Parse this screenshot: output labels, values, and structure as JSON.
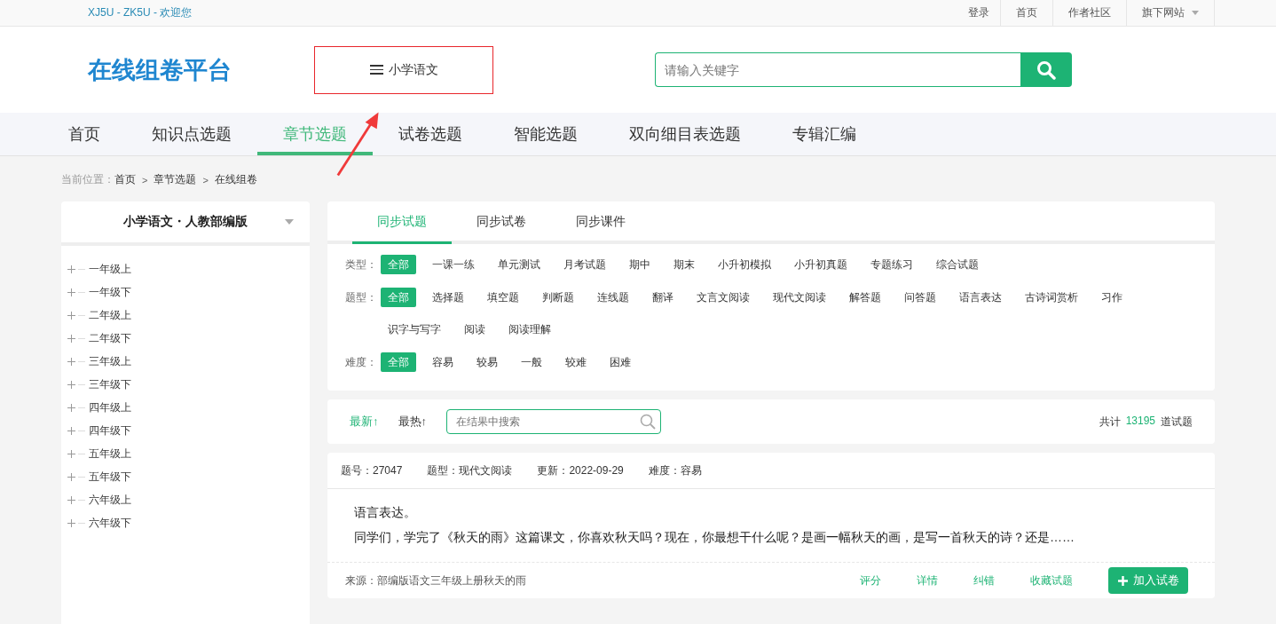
{
  "top_bar": {
    "welcome": "XJ5U - ZK5U - 欢迎您",
    "links": [
      "登录",
      "首页",
      "作者社区",
      "旗下网站"
    ]
  },
  "header": {
    "logo": "在线组卷平台",
    "subject": {
      "label": "小学语文",
      "highlighted": true
    },
    "search": {
      "placeholder": "请输入关键字"
    }
  },
  "nav": [
    {
      "label": "首页",
      "selected": false
    },
    {
      "label": "知识点选题",
      "selected": false
    },
    {
      "label": "章节选题",
      "selected": true
    },
    {
      "label": "试卷选题",
      "selected": false
    },
    {
      "label": "智能选题",
      "selected": false
    },
    {
      "label": "双向细目表选题",
      "selected": false
    },
    {
      "label": "专辑汇编",
      "selected": false
    }
  ],
  "breadcrumb": {
    "label": "当前位置：",
    "items": [
      "首页",
      "章节选题",
      "在线组卷"
    ],
    "separator": ">"
  },
  "sidebar": {
    "title": "小学语文・人教部编版",
    "tree": [
      {
        "label": "一年级上",
        "expanded": false
      },
      {
        "label": "一年级下",
        "expanded": false
      },
      {
        "label": "二年级上",
        "expanded": false
      },
      {
        "label": "二年级下",
        "expanded": false
      },
      {
        "label": "三年级上",
        "expanded": false
      },
      {
        "label": "三年级下",
        "expanded": false
      },
      {
        "label": "四年级上",
        "expanded": false
      },
      {
        "label": "四年级下",
        "expanded": false
      },
      {
        "label": "五年级上",
        "expanded": false
      },
      {
        "label": "五年级下",
        "expanded": false
      },
      {
        "label": "六年级上",
        "expanded": false
      },
      {
        "label": "六年级下",
        "expanded": false
      }
    ]
  },
  "tabs": [
    {
      "label": "同步试题",
      "selected": true
    },
    {
      "label": "同步试卷",
      "selected": false
    },
    {
      "label": "同步课件",
      "selected": false
    }
  ],
  "filters": [
    {
      "label": "类型：",
      "options": [
        {
          "label": "全部",
          "selected": true
        },
        {
          "label": "一课一练",
          "selected": false
        },
        {
          "label": "单元测试",
          "selected": false
        },
        {
          "label": "月考试题",
          "selected": false
        },
        {
          "label": "期中",
          "selected": false
        },
        {
          "label": "期末",
          "selected": false
        },
        {
          "label": "小升初模拟",
          "selected": false
        },
        {
          "label": "小升初真题",
          "selected": false
        },
        {
          "label": "专题练习",
          "selected": false
        },
        {
          "label": "综合试题",
          "selected": false
        }
      ]
    },
    {
      "label": "题型：",
      "options": [
        {
          "label": "全部",
          "selected": true
        },
        {
          "label": "选择题",
          "selected": false
        },
        {
          "label": "填空题",
          "selected": false
        },
        {
          "label": "判断题",
          "selected": false
        },
        {
          "label": "连线题",
          "selected": false
        },
        {
          "label": "翻译",
          "selected": false
        },
        {
          "label": "文言文阅读",
          "selected": false
        },
        {
          "label": "现代文阅读",
          "selected": false
        },
        {
          "label": "解答题",
          "selected": false
        },
        {
          "label": "问答题",
          "selected": false
        },
        {
          "label": "语言表达",
          "selected": false
        },
        {
          "label": "古诗词赏析",
          "selected": false
        },
        {
          "label": "习作",
          "selected": false
        },
        {
          "label": "识字与写字",
          "selected": false
        },
        {
          "label": "阅读",
          "selected": false
        },
        {
          "label": "阅读理解",
          "selected": false
        }
      ]
    },
    {
      "label": "难度：",
      "options": [
        {
          "label": "全部",
          "selected": true
        },
        {
          "label": "容易",
          "selected": false
        },
        {
          "label": "较易",
          "selected": false
        },
        {
          "label": "一般",
          "selected": false
        },
        {
          "label": "较难",
          "selected": false
        },
        {
          "label": "困难",
          "selected": false
        }
      ]
    }
  ],
  "sort": [
    {
      "label": "最新↑",
      "selected": true
    },
    {
      "label": "最热↑",
      "selected": false
    }
  ],
  "result_search": {
    "placeholder": "在结果中搜索"
  },
  "total": {
    "prefix": "共计",
    "count": "13195",
    "suffix": "道试题"
  },
  "questions": [
    {
      "meta": [
        "题号：27047",
        "题型：现代文阅读",
        "更新：2022-09-29",
        "难度：容易"
      ],
      "lines": [
        "语言表达。",
        "同学们，学完了《秋天的雨》这篇课文，你喜欢秋天吗？现在，你最想干什么呢？是画一幅秋天的画，是写一首秋天的诗？还是……"
      ],
      "source": "来源：部编版语文三年级上册秋天的雨",
      "actions": [
        "评分",
        "详情",
        "纠错",
        "收藏试题"
      ],
      "add_button": "加入试卷"
    }
  ]
}
